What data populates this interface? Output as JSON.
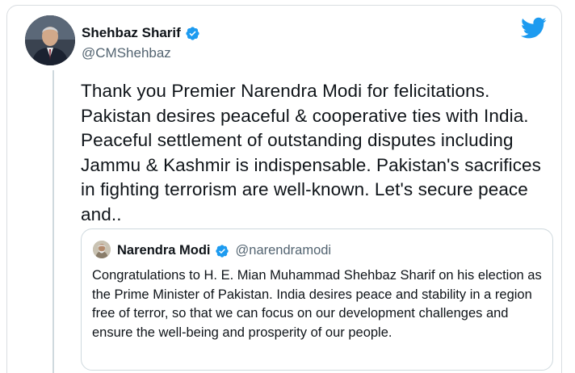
{
  "tweet": {
    "author_name": "Shehbaz Sharif",
    "author_handle": "@CMShehbaz",
    "text": "Thank you Premier Narendra Modi for felicitations. Pakistan desires peaceful & cooperative ties with India. Peaceful settlement of outstanding disputes including Jammu & Kashmir is indispensable. Pakistan's sacrifices in fighting terrorism are well-known. Let's secure peace and..",
    "verified": true
  },
  "quoted_tweet": {
    "author_name": "Narendra Modi",
    "author_handle": "@narendramodi",
    "verified": true,
    "text": "Congratulations to H. E. Mian Muhammad Shehbaz Sharif on his election as the Prime Minister of Pakistan. India desires peace and stability in a region free of terror, so that we can focus on our development challenges and ensure the well-being and prosperity of our people."
  },
  "icons": {
    "brand": "twitter-bird-icon",
    "verified": "verified-badge-icon"
  },
  "colors": {
    "brand_blue": "#1d9bf0",
    "text_primary": "#0f1419",
    "text_secondary": "#536471",
    "border": "#cfd9de"
  }
}
